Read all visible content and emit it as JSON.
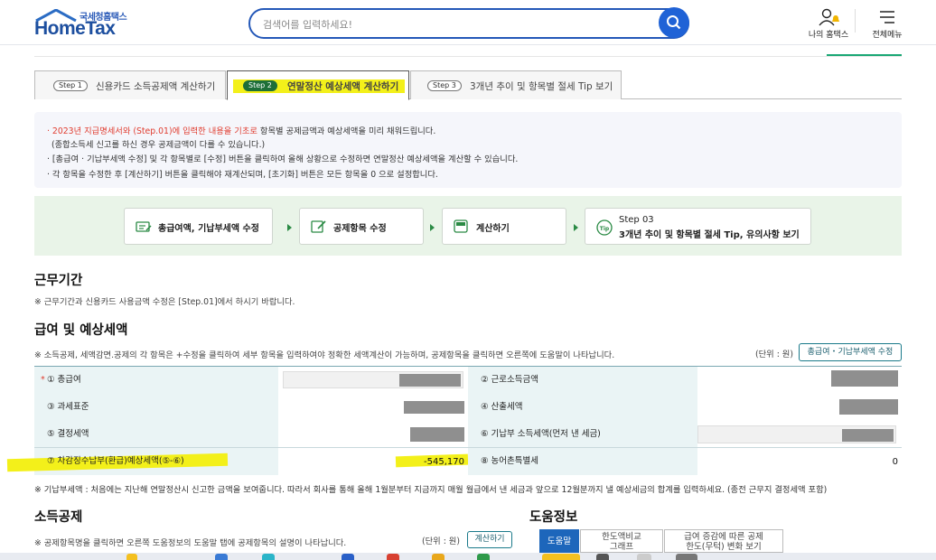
{
  "header": {
    "logo_sub": "국세청홈택스",
    "logo_main": "HomeTax",
    "search_placeholder": "검색어를 입력하세요!",
    "my_hometax": "나의 홈택스",
    "full_menu": "전체메뉴"
  },
  "tabs": [
    {
      "step": "Step 1",
      "label": "신용카드 소득공제액 계산하기"
    },
    {
      "step": "Step 2",
      "label": "연말정산 예상세액 계산하기"
    },
    {
      "step": "Step 3",
      "label": "3개년 추이 및 항목별 절세 Tip 보기"
    }
  ],
  "notice": {
    "l1_red": "2023년 지급명세서와 (Step.01)에 입력한 내용을 기초로",
    "l1_rest": " 항목별 공제금액과 예상세액을 미리 채워드립니다.",
    "l2": "(종합소득세 신고를 하신 경우 공제금액이 다를 수 있습니다.)",
    "l3": "[총급여 · 기납부세액 수정] 및 각 항목별로 [수정] 버튼을 클릭하여 올해 상황으로 수정하면 연말정산 예상세액을 계산할 수 있습니다.",
    "l4": "각 항목을 수정한 후 [계산하기] 버튼을 클릭해야 재계산되며, [초기화] 버튼은 모든 항목을 0 으로 설정합니다."
  },
  "steps": {
    "s1": "총급여액, 기납부세액 수정",
    "s2": "공제항목 수정",
    "s3": "계산하기",
    "s4a": "Step 03",
    "s4b": "3개년 추이 및 항목별 절세 Tip, 유의사항 보기"
  },
  "work_period": {
    "title": "근무기간",
    "note": "※ 근무기간과 신용카드 사용금액 수정은 [Step.01]에서 하시기 바랍니다."
  },
  "salary": {
    "title": "급여 및 예상세액",
    "note": "※ 소득공제, 세액감면.공제의 각 항목은 +수정을 클릭하여 세부 항목을 입력하여야 정확한 세액계산이 가능하며, 공제항목을 클릭하면 오른쪽에 도움말이 나타납니다.",
    "unit": "(단위 : 원)",
    "edit_button": "총급여・기납부세액 수정",
    "r1_l": "① 총급여",
    "r1_req": "*",
    "r1_r": "② 근로소득금액",
    "r2_l": "③ 과세표준",
    "r2_r": "④ 산출세액",
    "r3_l": "⑤ 결정세액",
    "r3_r": "⑥ 기납부 소득세액(먼저 낸 세금)",
    "r4_l": "⑦ 차감징수납부(환급)예상세액(⑤-⑥)",
    "r4_lv": "-545,170",
    "r4_r": "⑧ 농어촌특별세",
    "r4_rv": "0",
    "footnote": "※ 기납부세액 : 처음에는 지난해 연말정산시 신고한 금액을 보여줍니다. 따라서 회사를 통해 올해 1월분부터 지금까지 매월 월급에서 낸 세금과 앞으로 12월분까지 낼 예상세금의 합계를 입력하세요. (종전 근무지 결정세액 포함)"
  },
  "income_deduction": {
    "title": "소득공제",
    "note": "※ 공제항목명을 클릭하면 오른쪽 도움정보의 도움말 탭에 공제항목의 설명이 나타납니다.",
    "unit": "(단위 : 원)",
    "calc_button": "계산하기"
  },
  "help": {
    "title": "도움정보",
    "tab1": "도움말",
    "tab2a": "한도액비교",
    "tab2b": "그래프",
    "tab3a": "급여 증감에 따른 공제",
    "tab3b": "한도(무턱) 변화 보기"
  },
  "colors": {
    "brand": "#1d4f9f",
    "accent_green": "#1d6f38",
    "highlight": "#f3f01a"
  }
}
